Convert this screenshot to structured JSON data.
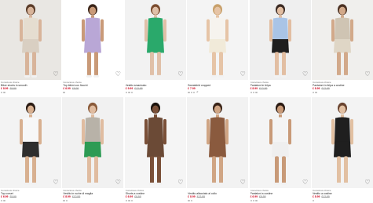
{
  "products": [
    {
      "tag": "Conscious choice",
      "name": "Biker shorts in smooth",
      "price": "£ 8.99",
      "old_price": "£9.99",
      "bg": "#e9e7e3",
      "top": "#e5ddd0",
      "bottom": "#d9cfc2",
      "skin": "#d8b49a",
      "hair": "#5a3b28",
      "swatches": [
        "#c9b8a4",
        "#222222"
      ],
      "more": ""
    },
    {
      "tag": "Conscious choice",
      "name": "Top bikini con fiocchi",
      "price": "£ 6.99",
      "old_price": "£8.99",
      "bg": "#ffffff",
      "top": "#b9a7d6",
      "bottom": "#b9a7d6",
      "skin": "#c99a78",
      "hair": "#3a2418",
      "swatches": [
        "#b9a7d6"
      ],
      "more": ""
    },
    {
      "tag": "",
      "name": "Vestito smanicato",
      "price": "£ 9.99",
      "old_price": "£12.99",
      "bg": "#f2f2f2",
      "top": "#2aa96b",
      "bottom": "#2aa96b",
      "skin": "#e0c0a8",
      "hair": "#7a4a2c",
      "swatches": [
        "#2aa96b",
        "#222222",
        "#e8e0d2"
      ],
      "more": ""
    },
    {
      "tag": "",
      "name": "Sweatshirt cropped",
      "price": "£ 7.99",
      "old_price": "",
      "bg": "#f4f4f4",
      "top": "#f6f3ee",
      "bottom": "#f1ead9",
      "skin": "#e6c4a6",
      "hair": "#c8a06a",
      "swatches": [
        "#f1ead9",
        "#999999",
        "#222222"
      ],
      "more": "+2"
    },
    {
      "tag": "Conscious choice",
      "name": "Pantaloni in felpa",
      "price": "£ 8.99",
      "old_price": "£12.99",
      "bg": "#efefef",
      "top": "#a9c4e6",
      "bottom": "#1e1e1e",
      "skin": "#e2bea2",
      "hair": "#3b2a22",
      "swatches": [
        "#a9c4e6",
        "#1e1e1e",
        "#f0f0f0"
      ],
      "more": ""
    },
    {
      "tag": "Conscious choice",
      "name": "Pantaloni in felpa a costine",
      "price": "£ 8.99",
      "old_price": "£12.99",
      "bg": "#f0efed",
      "top": "#cfc4b3",
      "bottom": "#dfd6c6",
      "skin": "#d2a98a",
      "hair": "#4a3022",
      "swatches": [
        "#cfc4b3",
        "#777777"
      ],
      "more": ""
    },
    {
      "tag": "Conscious choice",
      "name": "Top corset",
      "price": "£ 6.99",
      "old_price": "£9.99",
      "bg": "#f3f3f3",
      "top": "#f7f7f7",
      "bottom": "#2e2e2e",
      "skin": "#d8b090",
      "hair": "#2a1a12",
      "swatches": [
        "#f7f7f7",
        "#222222"
      ],
      "more": ""
    },
    {
      "tag": "Conscious choice",
      "name": "Vestito in ruche di maglia",
      "price": "£ 8.99",
      "old_price": "£12.99",
      "bg": "#f1f1f1",
      "top": "#b8b2a8",
      "bottom": "#2d9b54",
      "skin": "#e0bca0",
      "hair": "#8a5a3a",
      "swatches": [
        "#b8b2a8",
        "#2d9b54"
      ],
      "more": ""
    },
    {
      "tag": "Conscious choice",
      "name": "Shorts a costine",
      "price": "£ 6.99",
      "old_price": "£9.99",
      "bg": "#f5f5f5",
      "top": "#6b4a36",
      "bottom": "#6b4a36",
      "skin": "#7a5038",
      "hair": "#1a120c",
      "swatches": [
        "#6b4a36",
        "#222222",
        "#d8cbb8"
      ],
      "more": ""
    },
    {
      "tag": "",
      "name": "Vestito allacciato al collo",
      "price": "£ 8.99",
      "old_price": "£12.99",
      "bg": "#f2f2f2",
      "top": "#8a5a3e",
      "bottom": "#8a5a3e",
      "skin": "#d0a584",
      "hair": "#3a2418",
      "swatches": [
        "#8a5a3e",
        "#222222"
      ],
      "more": ""
    },
    {
      "tag": "Conscious choice",
      "name": "Pantaloni a costine",
      "price": "£ 6.99",
      "old_price": "£9.99",
      "bg": "#f4f4f4",
      "top": "#f4f4f4",
      "bottom": "#efefef",
      "skin": "#c89a78",
      "hair": "#2a1a12",
      "swatches": [
        "#efefef",
        "#222222",
        "#c6a98a"
      ],
      "more": ""
    },
    {
      "tag": "Conscious choice",
      "name": "Vestito a costine",
      "price": "£ 8.99",
      "old_price": "£12.99",
      "bg": "#f3f3f3",
      "top": "#1f1f1f",
      "bottom": "#1f1f1f",
      "skin": "#e2c0a2",
      "hair": "#6a4430",
      "swatches": [
        "#1f1f1f"
      ],
      "more": ""
    }
  ],
  "icons": {
    "favorite": "heart-icon"
  }
}
